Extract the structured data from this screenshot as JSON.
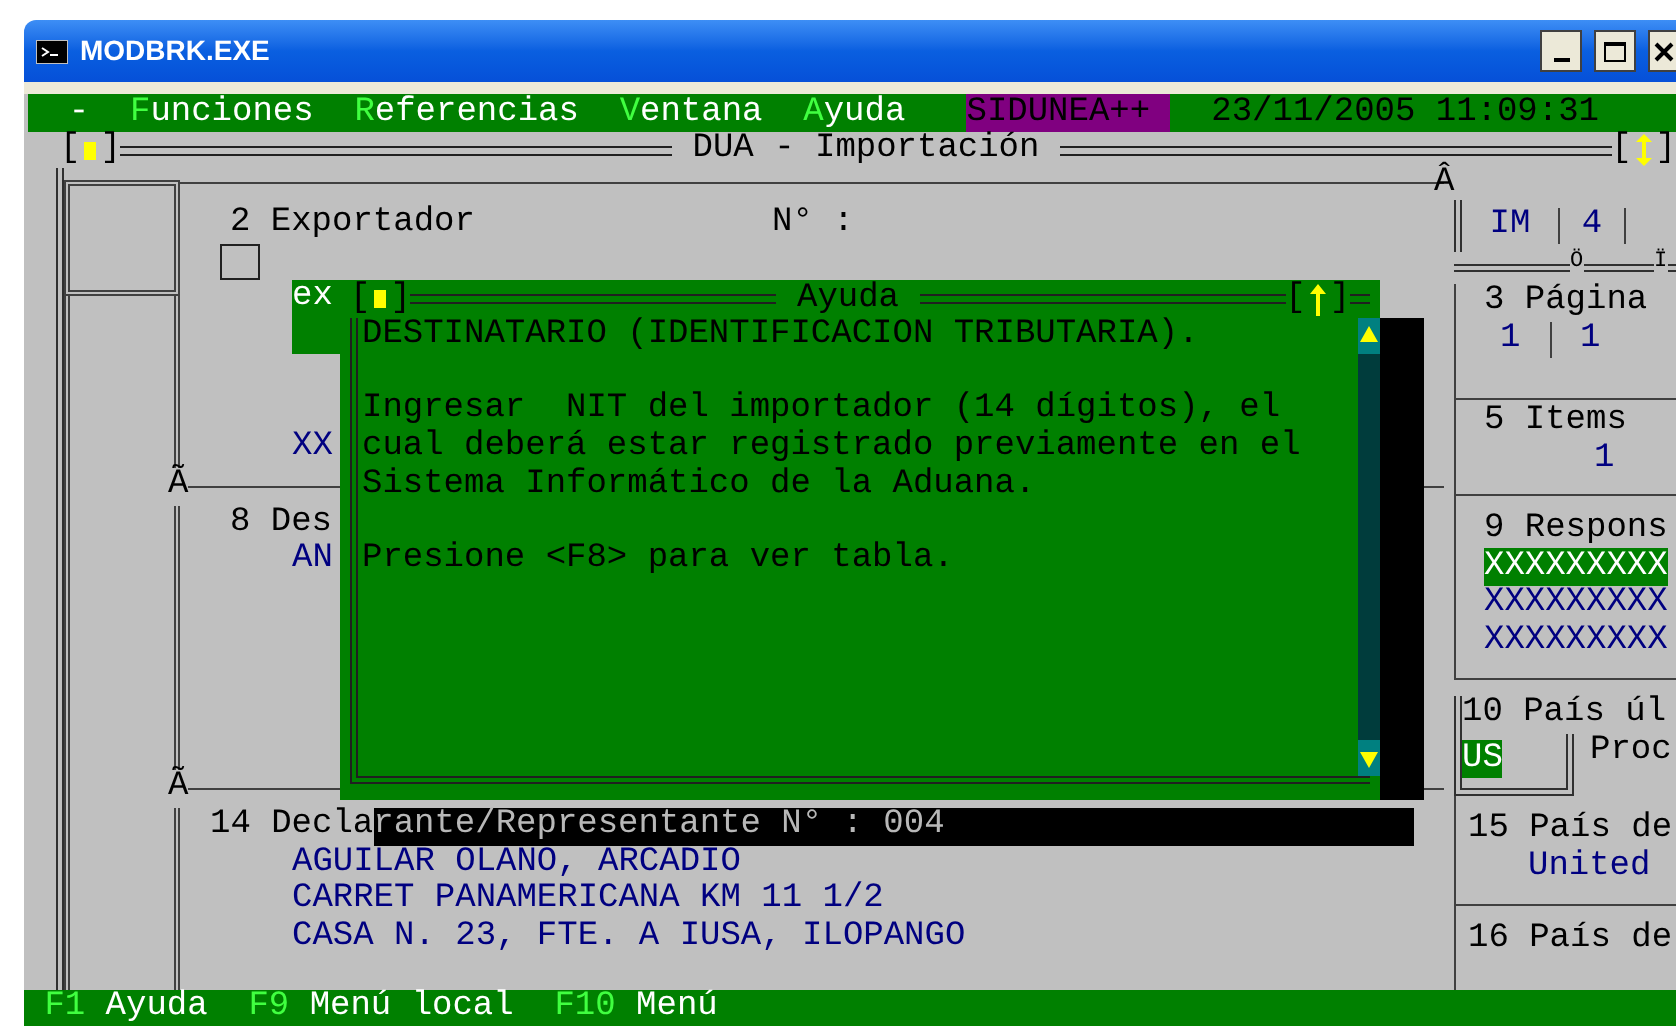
{
  "window": {
    "title": "MODBRK.EXE"
  },
  "menu_bar": {
    "system_menu": "-",
    "items": [
      {
        "hotkey": "F",
        "rest": "unciones"
      },
      {
        "hotkey": "R",
        "rest": "eferencias"
      },
      {
        "hotkey": "V",
        "rest": "entana"
      },
      {
        "hotkey": "A",
        "rest": "yuda"
      }
    ],
    "app_badge": "SIDUNEA++",
    "datetime": "23/11/2005 11:09:31"
  },
  "form": {
    "title": "DUA - Importación",
    "close_box": [
      "[",
      "]"
    ],
    "resize_box": [
      "[",
      "]"
    ],
    "junctions": {
      "top_right": "Â",
      "left_upper": "Ã",
      "left_lower": "Ã",
      "doc_type_mid": "Ö",
      "doc_type_right": "Ï"
    },
    "exporter": {
      "label": "2 Exportador",
      "number_label": "N° :",
      "checked": false,
      "field_text": "ex",
      "value": "XX"
    },
    "consignee": {
      "label": "8 Des",
      "value": "AN"
    },
    "declarant": {
      "label": "14 Decla",
      "label_shadowed": "rante/Representante N° : 004",
      "lines": [
        "AGUILAR OLANO, ARCADIO",
        "CARRET PANAMERICANA KM 11 1/2",
        "CASA N. 23, FTE. A IUSA, ILOPANGO"
      ]
    },
    "doc_type": [
      "IM",
      "4"
    ],
    "page": {
      "label": "3 Página",
      "values": [
        "1",
        "1"
      ]
    },
    "items": {
      "label": "5 Items",
      "value": "1"
    },
    "responsible": {
      "label": "9 Respons",
      "lines": [
        {
          "text": "XXXXXXXXX",
          "selected": true
        },
        {
          "text": "XXXXXXXXX",
          "selected": false
        },
        {
          "text": "XXXXXXXXX",
          "selected": false
        }
      ]
    },
    "last_country": {
      "label": "10 País úl",
      "code": "US",
      "next": "Proc"
    },
    "box15": {
      "label": "15 País de",
      "value": "United"
    },
    "box16": {
      "label": "16 País de"
    }
  },
  "help_popup": {
    "title": "Ayuda",
    "close_box": [
      "[",
      "]"
    ],
    "scroll_box": [
      "[",
      "]"
    ],
    "paragraphs": [
      [
        "DESTINATARIO (IDENTIFICACION TRIBUTARIA)."
      ],
      [
        "Ingresar  NIT del importador (14 dígitos), el",
        "cual deberá estar registrado previamente en el",
        "Sistema Informático de la Aduana."
      ],
      [
        "Presione <F8> para ver tabla."
      ]
    ]
  },
  "status_bar": [
    {
      "key": "F1",
      "label": "Ayuda"
    },
    {
      "key": "F9",
      "label": "Menú local"
    },
    {
      "key": "F10",
      "label": "Menú"
    }
  ]
}
